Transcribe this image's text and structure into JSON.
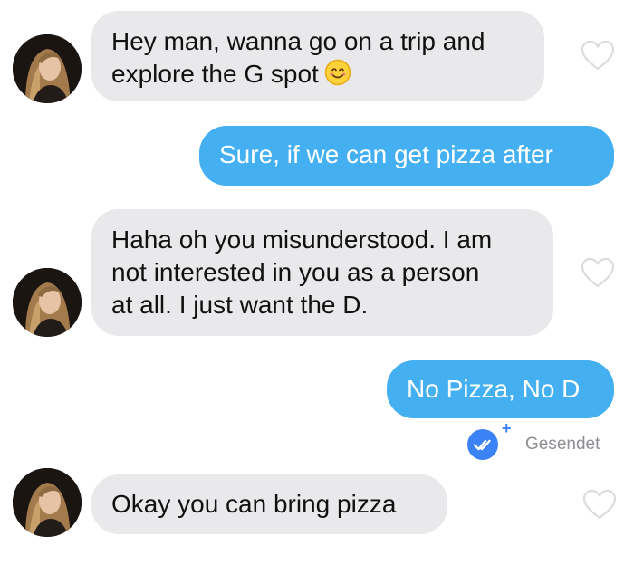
{
  "messages": [
    {
      "sender": "match",
      "lines": [
        "Hey man, wanna go on a trip and",
        "explore the G spot"
      ],
      "emoji": "smiling-face",
      "liked": false
    },
    {
      "sender": "me",
      "lines": [
        "Sure, if we can get pizza after"
      ]
    },
    {
      "sender": "match",
      "lines": [
        "Haha oh you misunderstood. I am",
        "not interested in you as a person",
        "at all. I just want the D."
      ],
      "liked": false
    },
    {
      "sender": "me",
      "lines": [
        "No Pizza, No D"
      ]
    },
    {
      "sender": "match",
      "lines": [
        "Okay you can bring pizza"
      ],
      "liked": false
    }
  ],
  "receipt": {
    "status": "Gesendet",
    "icon": "double-check-icon",
    "badge": "+"
  },
  "colors": {
    "incoming_bubble": "#e9e9eb",
    "outgoing_bubble": "#44b0f2",
    "receipt_badge": "#3a82f6",
    "heart_outline": "#dcdcdf"
  }
}
